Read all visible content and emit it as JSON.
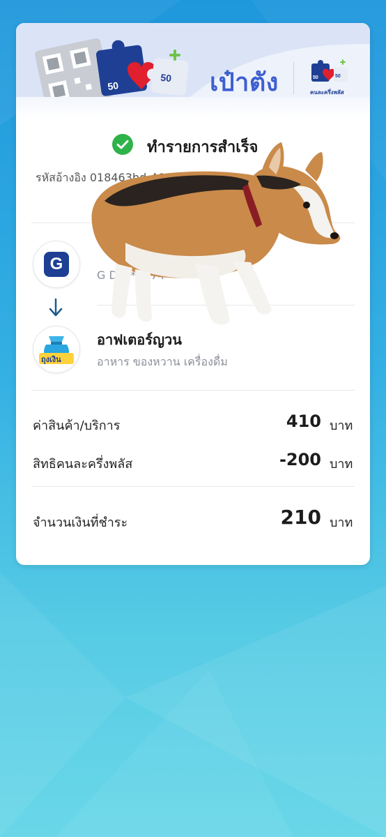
{
  "header": {
    "wallet_title": "เป๋าตัง",
    "logo_left_number_a": "50",
    "logo_left_number_b": "50",
    "logo_right_number_a": "50",
    "logo_right_number_b": "50",
    "logo_right_caption": "คนละครึ่งพลัส"
  },
  "status": {
    "text": "ทำรายการสำเร็จ",
    "icon": "check-circle-icon",
    "color": "#2fb24a"
  },
  "reference": {
    "label": "รหัสอ้างอิง",
    "value": "018463bd-46e7-4c6      3be5"
  },
  "from": {
    "title": "",
    "sub": "G              D: ****        74",
    "icon_letter": "G"
  },
  "to": {
    "title": "อาฟเตอร์ญวน",
    "sub": "อาหาร ของหวาน เครื่องดื่ม",
    "icon_caption": "ถุงเงิน"
  },
  "amounts": {
    "goods_label": "ค่าสินค้า/บริการ",
    "goods_value": "410",
    "discount_label": "สิทธิคนละครึ่งพลัส",
    "discount_value": "-200",
    "total_label": "จำนวนเงินที่ชำระ",
    "total_value": "210",
    "unit": "บาท"
  },
  "colors": {
    "brand_blue": "#3d5fd0",
    "success_green": "#2fb24a",
    "background_top": "#1f97dc",
    "background_bottom": "#6ad7e8"
  }
}
